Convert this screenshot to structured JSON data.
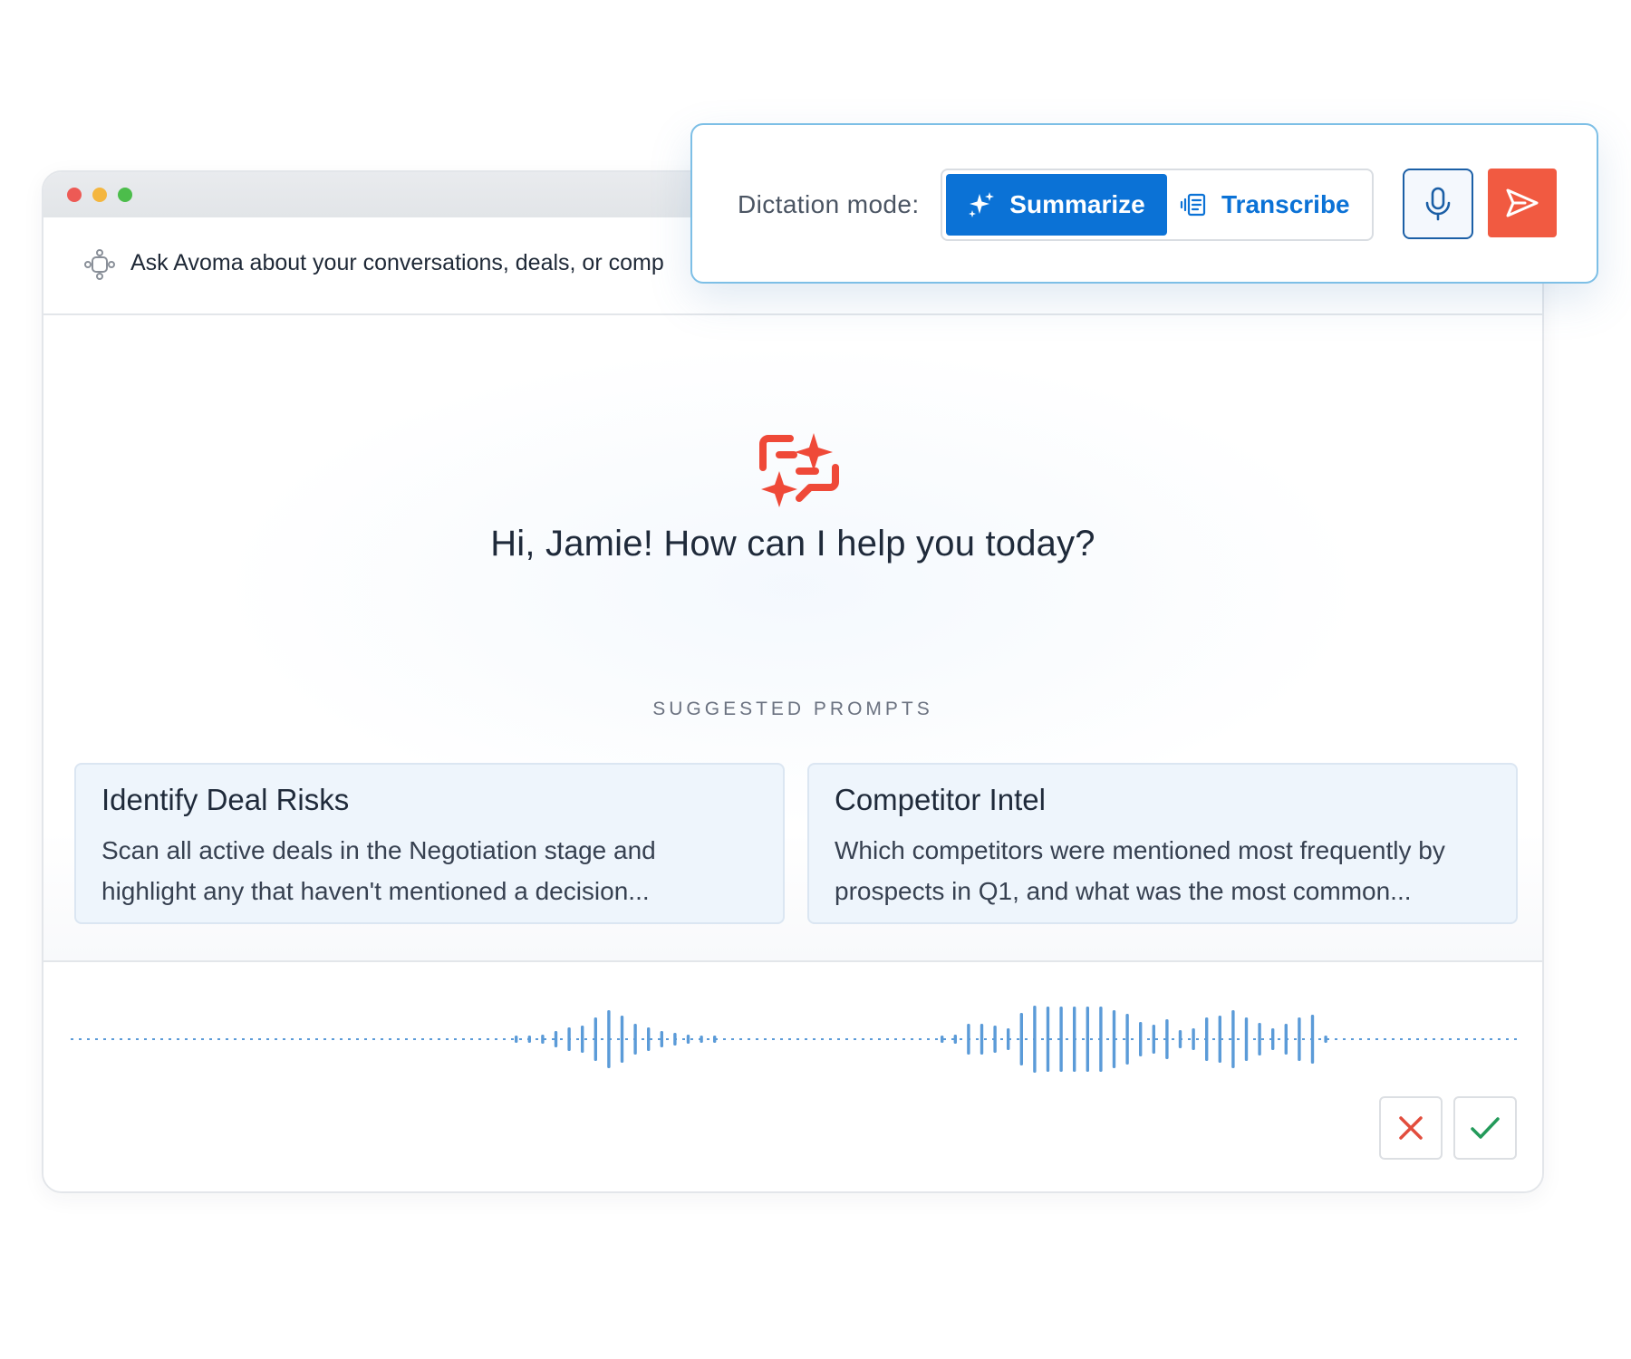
{
  "ask_bar": {
    "placeholder": "Ask Avoma about your conversations, deals, or comp",
    "icon": "assistant-bot-icon"
  },
  "main": {
    "greeting": "Hi, Jamie! How can I help you today?",
    "logo_icon": "avoma-ai-chat-sparkle-icon",
    "suggested_title": "SUGGESTED PROMPTS",
    "prompts": [
      {
        "title": "Identify Deal Risks",
        "body_lines": [
          "Scan all active deals in the Negotiation stage and",
          "highlight any that haven't mentioned a decision..."
        ]
      },
      {
        "title": "Competitor Intel",
        "body_lines": [
          "Which competitors were mentioned most frequently by",
          "prospects in Q1, and what was the most common..."
        ]
      }
    ]
  },
  "dictation": {
    "mode_label": "Dictation mode:",
    "modes": [
      {
        "label": "Summarize",
        "icon": "sparkles-icon",
        "selected": true
      },
      {
        "label": "Transcribe",
        "icon": "transcribe-icon",
        "selected": false
      }
    ],
    "mic_icon": "microphone-icon",
    "send_icon": "send-icon"
  },
  "recording": {
    "waveform_icon": "audio-waveform",
    "cancel_icon": "close-icon",
    "confirm_icon": "checkmark-icon"
  },
  "colors": {
    "primary_blue": "#0b72d6",
    "accent_red": "#f15a41",
    "waveform_blue": "#5b9bd8",
    "cancel_red": "#e24d3d",
    "confirm_green": "#239a5a",
    "card_background": "#eef5fc",
    "panel_border": "#7dbfe6"
  }
}
